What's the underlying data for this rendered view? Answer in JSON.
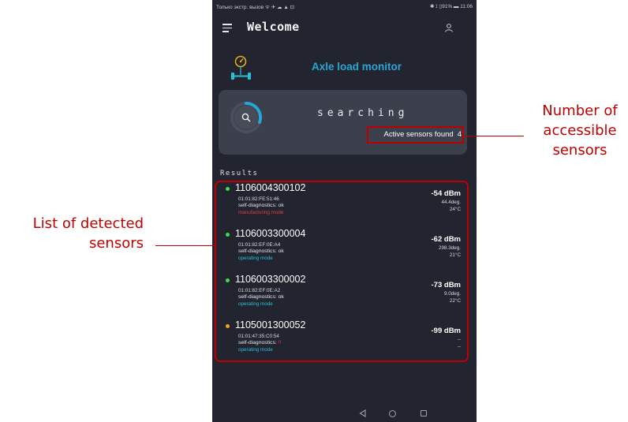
{
  "status_bar": {
    "left": "Только экстр. вызов ᯤ ✈ ☁ ▲ ⊡",
    "right": "✱ ⟟ ▯91% ▬ 11:06"
  },
  "app_bar": {
    "title": "Welcome"
  },
  "brand": {
    "title": "Axle load monitor"
  },
  "search": {
    "status": "searching",
    "sensors_found_label": "Active sensors found",
    "sensors_found_count": "4"
  },
  "results": {
    "heading": "Results",
    "sensors": [
      {
        "id": "1106004300102",
        "mac": "01:01:82:FE:51:46",
        "diag_label": "self-diagnostics:",
        "diag_value": "ok",
        "mode": "manufacturing mode",
        "rssi": "-54 dBm",
        "angle": "44.4deg.",
        "temp": "24°C"
      },
      {
        "id": "1106003300004",
        "mac": "01:01:82:EF:0E:A4",
        "diag_label": "self-diagnostics:",
        "diag_value": "ok",
        "mode": "operating mode",
        "rssi": "-62 dBm",
        "angle": "298.3deg.",
        "temp": "21°C"
      },
      {
        "id": "1106003300002",
        "mac": "01:01:82:EF:0E:A2",
        "diag_label": "self-diagnostics:",
        "diag_value": "ok",
        "mode": "operating mode",
        "rssi": "-73 dBm",
        "angle": "9.0deg.",
        "temp": "22°C"
      },
      {
        "id": "1105001300052",
        "mac": "01:01:47:35:C0:54",
        "diag_label": "self-diagnostics:",
        "diag_value": "!!",
        "mode": "operating mode",
        "rssi": "-99 dBm",
        "angle": "--",
        "temp": "--"
      }
    ]
  },
  "annotations": {
    "sensors_found": "Number of accessible sensors",
    "sensor_list": "List of detected sensors"
  },
  "icons": {
    "menu": "menu-icon",
    "user": "user-icon",
    "logo": "axle-logo-icon",
    "search": "search-icon",
    "back": "nav-back-icon",
    "home": "nav-home-icon",
    "recent": "nav-recent-icon"
  },
  "colors": {
    "background": "#22252f",
    "card": "#3c404c",
    "accent": "#27a6d6",
    "status_ok": "#3ddc52",
    "status_warn": "#e8a91c",
    "mode_operating": "#27c1d6",
    "mode_manufacturing": "#e53e3e",
    "annotation": "#c00000"
  }
}
